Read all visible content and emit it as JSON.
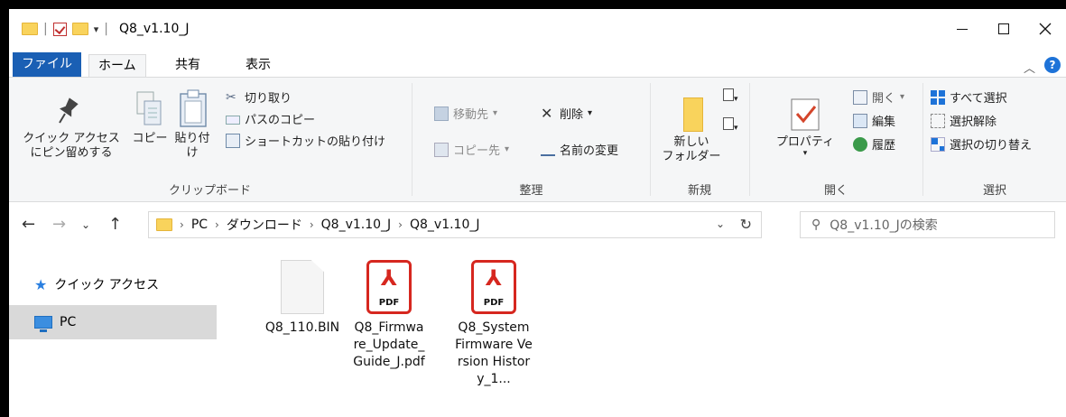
{
  "window": {
    "title": "Q8_v1.10_J",
    "controls": {
      "minimize": "—",
      "maximize": "☐",
      "close": "✕"
    }
  },
  "ribbon_tabs": [
    {
      "label": "ファイル"
    },
    {
      "label": "ホーム"
    },
    {
      "label": "共有"
    },
    {
      "label": "表示"
    }
  ],
  "ribbon": {
    "clipboard": {
      "pin_label_1": "クイック アクセス",
      "pin_label_2": "にピン留めする",
      "copy": "コピー",
      "paste": "貼り付け",
      "cut": "切り取り",
      "copy_path": "パスのコピー",
      "paste_shortcut": "ショートカットの貼り付け",
      "group_label": "クリップボード"
    },
    "organize": {
      "move_to": "移動先",
      "delete": "削除",
      "copy_to": "コピー先",
      "rename": "名前の変更",
      "group_label": "整理"
    },
    "new": {
      "new_folder_1": "新しい",
      "new_folder_2": "フォルダー",
      "group_label": "新規"
    },
    "open": {
      "properties": "プロパティ",
      "open": "開く",
      "edit": "編集",
      "history": "履歴",
      "group_label": "開く"
    },
    "select": {
      "select_all": "すべて選択",
      "select_none": "選択解除",
      "invert": "選択の切り替え",
      "group_label": "選択"
    }
  },
  "address": {
    "crumbs": [
      "PC",
      "ダウンロード",
      "Q8_v1.10_J",
      "Q8_v1.10_J"
    ],
    "separator": "›"
  },
  "search": {
    "placeholder": "Q8_v1.10_Jの検索"
  },
  "nav_pane": [
    {
      "label": "クイック アクセス"
    },
    {
      "label": "PC"
    }
  ],
  "files": [
    {
      "name": "Q8_110.BIN",
      "type": "file"
    },
    {
      "name": "Q8_Firmware_Update_Guide_J.pdf",
      "display": "Q8_Firmwa re_Update_ Guide_J.pdf",
      "type": "pdf"
    },
    {
      "name": "Q8_System Firmware Version History_1...",
      "display": "Q8_System Firmware Version History_1...",
      "type": "pdf"
    }
  ],
  "icons": {
    "pdf_label": "PDF",
    "pdf_color": "#d6271f",
    "accent_color": "#1a5fb4"
  }
}
